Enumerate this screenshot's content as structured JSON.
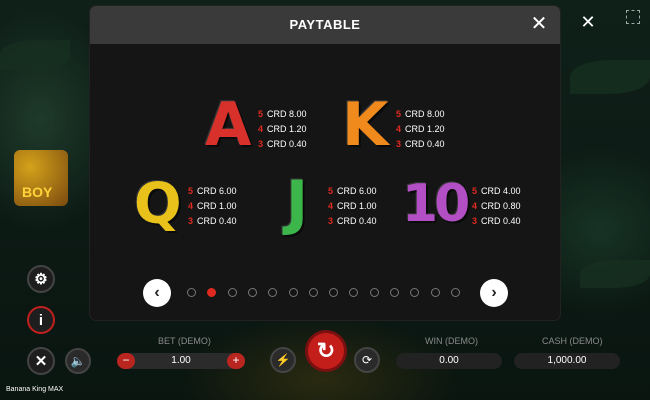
{
  "background": {
    "corner_close_label": "✕",
    "side_symbol_label": "BOY"
  },
  "left_buttons": [
    {
      "name": "settings-button",
      "icon": "gear-icon",
      "glyph": "⚙"
    },
    {
      "name": "info-button",
      "icon": "info-icon",
      "glyph": "i"
    },
    {
      "name": "close-game-button",
      "icon": "close-icon",
      "glyph": "✕"
    }
  ],
  "sound_icon_glyph": "🔈",
  "bottom_bar": {
    "bet_label": "BET (DEMO)",
    "bet_value": "1.00",
    "bet_minus": "−",
    "bet_plus": "+",
    "win_label": "WIN (DEMO)",
    "win_value": "0.00",
    "cash_label": "CASH (DEMO)",
    "cash_value": "1,000.00",
    "turbo_glyph": "⚡",
    "spin_glyph": "↻",
    "autoplay_glyph": "⟳"
  },
  "footer_title": "Banana King MAX",
  "paytable": {
    "title": "PAYTABLE",
    "close_label": "✕",
    "prev_label": "‹",
    "next_label": "›",
    "page_count": 14,
    "active_page": 2,
    "colors": {
      "accent": "#e02a1f"
    },
    "symbols": [
      {
        "letter": "A",
        "color": "#d8302b",
        "pays": [
          {
            "n": "5",
            "v": "CRD 8.00"
          },
          {
            "n": "4",
            "v": "CRD 1.20"
          },
          {
            "n": "3",
            "v": "CRD 0.40"
          }
        ]
      },
      {
        "letter": "K",
        "color": "#f08a1c",
        "pays": [
          {
            "n": "5",
            "v": "CRD 8.00"
          },
          {
            "n": "4",
            "v": "CRD 1.20"
          },
          {
            "n": "3",
            "v": "CRD 0.40"
          }
        ]
      },
      {
        "letter": "Q",
        "color": "#e8c21a",
        "pays": [
          {
            "n": "5",
            "v": "CRD 6.00"
          },
          {
            "n": "4",
            "v": "CRD 1.00"
          },
          {
            "n": "3",
            "v": "CRD 0.40"
          }
        ]
      },
      {
        "letter": "J",
        "color": "#3cb54a",
        "pays": [
          {
            "n": "5",
            "v": "CRD 6.00"
          },
          {
            "n": "4",
            "v": "CRD 1.00"
          },
          {
            "n": "3",
            "v": "CRD 0.40"
          }
        ]
      },
      {
        "letter": "10",
        "color": "#b34fc4",
        "pays": [
          {
            "n": "5",
            "v": "CRD 4.00"
          },
          {
            "n": "4",
            "v": "CRD 0.80"
          },
          {
            "n": "3",
            "v": "CRD 0.40"
          }
        ]
      }
    ]
  }
}
